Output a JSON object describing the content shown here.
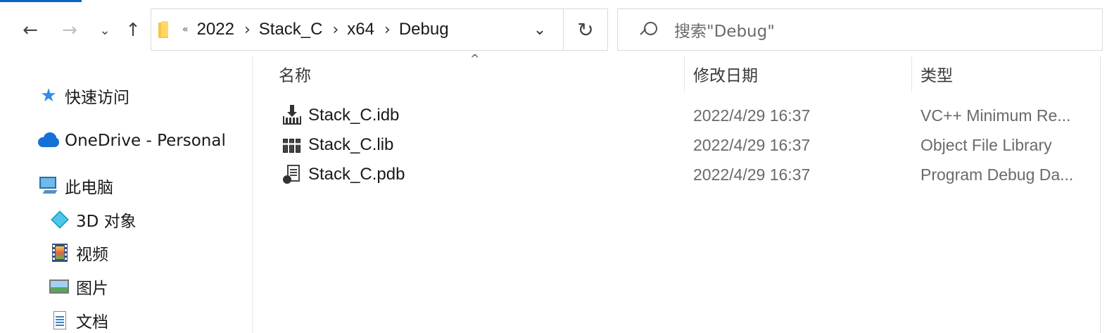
{
  "toolbar": {
    "back_icon": "arrow-left-icon",
    "forward_icon": "arrow-right-icon",
    "recent_icon": "chevron-down-icon",
    "up_icon": "arrow-up-icon"
  },
  "address": {
    "overflow": "«",
    "crumbs": [
      "2022",
      "Stack_C",
      "x64",
      "Debug"
    ],
    "separator": "›",
    "dropdown": "⌄",
    "refresh": "↻"
  },
  "search": {
    "placeholder": "搜索\"Debug\""
  },
  "sidebar": {
    "items": [
      {
        "label": "快速访问",
        "icon": "star-icon"
      },
      {
        "label": "OneDrive - Personal",
        "icon": "cloud-icon"
      },
      {
        "label": "此电脑",
        "icon": "computer-icon"
      },
      {
        "label": "3D 对象",
        "icon": "cube-icon"
      },
      {
        "label": "视频",
        "icon": "video-icon"
      },
      {
        "label": "图片",
        "icon": "picture-icon"
      },
      {
        "label": "文档",
        "icon": "document-icon"
      }
    ]
  },
  "list": {
    "columns": {
      "name": "名称",
      "date": "修改日期",
      "type": "类型"
    },
    "sort_indicator": "^",
    "files": [
      {
        "name": "Stack_C.idb",
        "date": "2022/4/29 16:37",
        "type": "VC++ Minimum Re...",
        "icon": "idb-file-icon"
      },
      {
        "name": "Stack_C.lib",
        "date": "2022/4/29 16:37",
        "type": "Object File Library",
        "icon": "lib-file-icon"
      },
      {
        "name": "Stack_C.pdb",
        "date": "2022/4/29 16:37",
        "type": "Program Debug Da...",
        "icon": "pdb-file-icon"
      }
    ]
  }
}
